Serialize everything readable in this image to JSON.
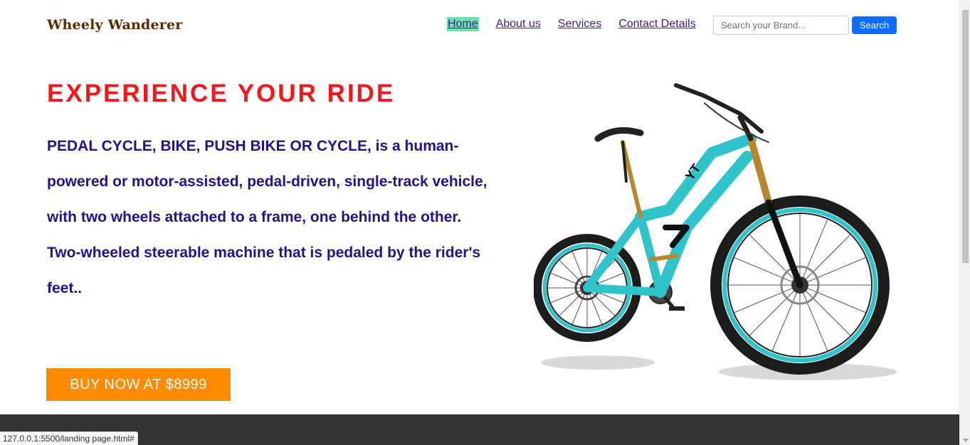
{
  "header": {
    "brand": "Wheely Wanderer",
    "nav": [
      "Home",
      "About us",
      "Services",
      "Contact Details"
    ],
    "active_nav": "Home",
    "search": {
      "placeholder": "Search your Brand...",
      "button_label": "Search"
    }
  },
  "hero": {
    "title": "EXPERIENCE YOUR RIDE",
    "paragraph1": "PEDAL CYCLE, BIKE, PUSH BIKE OR CYCLE, is a human-powered or motor-assisted, pedal-driven, single-track vehicle, with two wheels attached to a frame, one behind the other.",
    "paragraph2": "Two-wheeled steerable machine that is pedaled by the rider's feet..",
    "cta_label": "BUY NOW AT $8999",
    "image": "mountain-bike-teal"
  },
  "status_bar": {
    "url": "127.0.0.1:5500/landing page.html#"
  },
  "colors": {
    "brand": "#5a2a00",
    "nav_link": "#3b1f86",
    "nav_active_bg": "#6fe0b0",
    "title": "#f5171c",
    "body_text": "#24128a",
    "cta_bg": "#ff8c00",
    "search_button": "#0d6efd",
    "footer": "#333333",
    "bike_frame": "#2ec4c9"
  }
}
